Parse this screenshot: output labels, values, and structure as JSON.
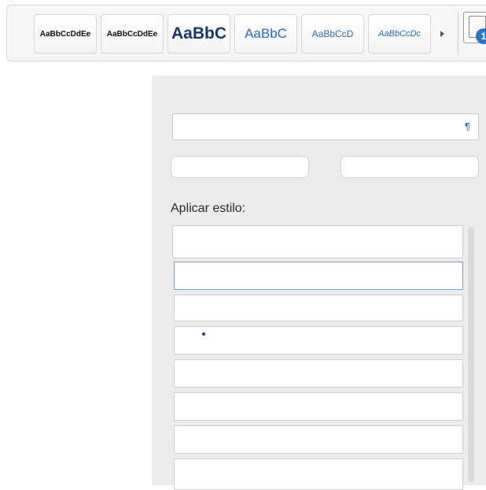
{
  "ribbon": {
    "styles": [
      {
        "label": "AaBbCcDdEe",
        "name": "normal"
      },
      {
        "label": "AaBbCcDdEe",
        "name": "no-spacing"
      },
      {
        "label": "AaBbC",
        "name": "heading-1"
      },
      {
        "label": "AaBbC",
        "name": "heading-2"
      },
      {
        "label": "AaBbCcD",
        "name": "title"
      },
      {
        "label": "AaBbCcDc",
        "name": "subtitle"
      }
    ],
    "pane_badge": "1"
  },
  "pane": {
    "style_field_value": "",
    "pilcrow": "¶",
    "new_style_label": "",
    "clear_style_label": "",
    "apply_style_label": "Aplicar estilo:",
    "list_items": [
      "",
      "",
      "",
      "",
      "",
      "",
      "",
      ""
    ]
  },
  "colors": {
    "heading_blue": "#2e6bb2",
    "heading_dark": "#1a3a63",
    "badge_blue": "#2d75c7",
    "pane_bg": "#ececec"
  }
}
